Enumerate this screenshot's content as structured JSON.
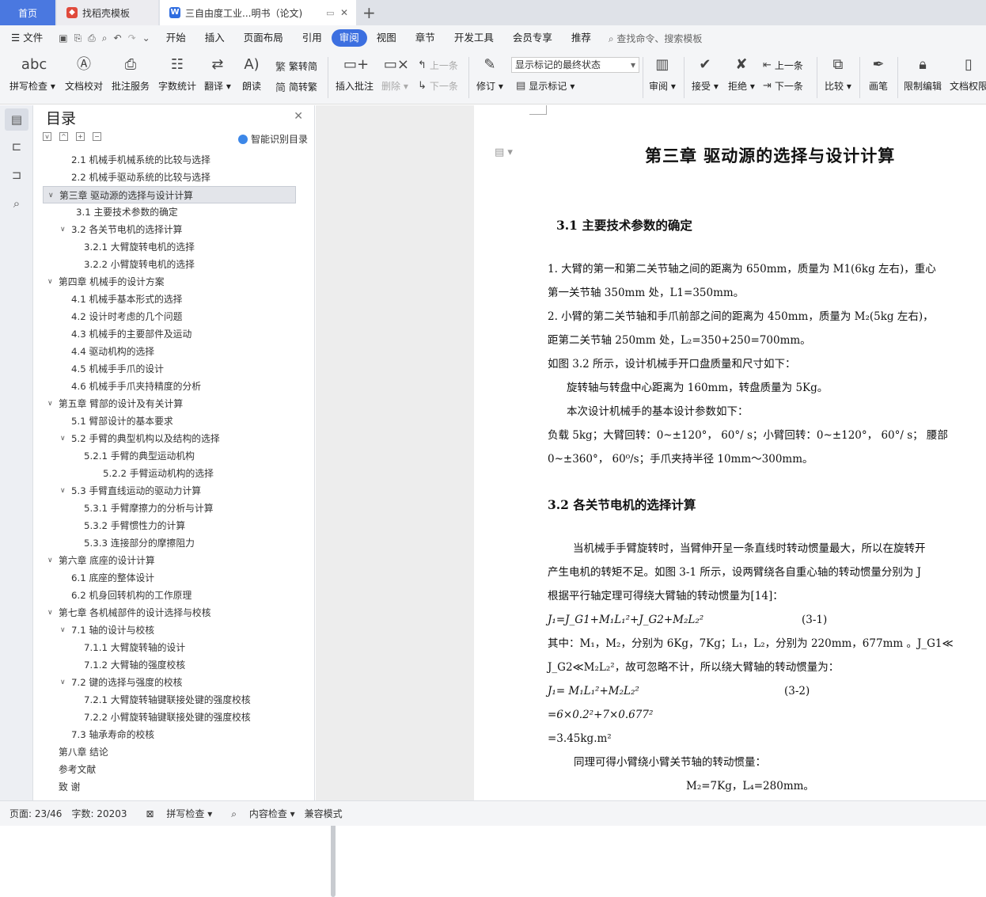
{
  "tabs": {
    "home": "首页",
    "template": "找稻壳模板",
    "document": "三自由度工业...明书（论文)"
  },
  "menu": {
    "file": "文件",
    "items": [
      "开始",
      "插入",
      "页面布局",
      "引用",
      "审阅",
      "视图",
      "章节",
      "开发工具",
      "会员专享",
      "推荐"
    ],
    "active_index": 4,
    "search": "查找命令、搜索模板"
  },
  "ribbon": {
    "spellcheck": "拼写检查",
    "proofread": "文档校对",
    "annotate_service": "批注服务",
    "word_count": "字数统计",
    "translate": "翻译",
    "read_aloud": "朗读",
    "trad": "繁转简",
    "simp": "简转繁",
    "insert_comment": "插入批注",
    "delete": "删除",
    "prev_comment": "上一条",
    "next_comment": "下一条",
    "revise": "修订",
    "markup_combo": "显示标记的最终状态",
    "show_markup": "显示标记",
    "review": "审阅",
    "accept": "接受",
    "reject": "拒绝",
    "prev_change": "上一条",
    "next_change": "下一条",
    "compare": "比较",
    "pen": "画笔",
    "restrict": "限制编辑",
    "doc_rights": "文档权限"
  },
  "toc": {
    "title": "目录",
    "smart": "智能识别目录",
    "items": [
      {
        "text": "2.1   机械手机械系统的比较与选择",
        "indent": 36,
        "arrow": ""
      },
      {
        "text": "2.2   机械手驱动系统的比较与选择",
        "indent": 36,
        "arrow": ""
      },
      {
        "text": "第三章   驱动源的选择与设计计算",
        "indent": 20,
        "arrow": "v",
        "selected": true
      },
      {
        "text": "3.1   主要技术参数的确定",
        "indent": 42,
        "arrow": ""
      },
      {
        "text": "3.2   各关节电机的选择计算",
        "indent": 36,
        "arrow": "v"
      },
      {
        "text": "3.2.1   大臂旋转电机的选择",
        "indent": 52,
        "arrow": ""
      },
      {
        "text": "3.2.2   小臂旋转电机的选择",
        "indent": 52,
        "arrow": ""
      },
      {
        "text": "第四章   机械手的设计方案",
        "indent": 20,
        "arrow": "v"
      },
      {
        "text": "4.1  机械手基本形式的选择",
        "indent": 36,
        "arrow": ""
      },
      {
        "text": "4.2   设计时考虑的几个问题",
        "indent": 36,
        "arrow": ""
      },
      {
        "text": "4.3 机械手的主要部件及运动",
        "indent": 36,
        "arrow": ""
      },
      {
        "text": "4.4 驱动机构的选择",
        "indent": 36,
        "arrow": ""
      },
      {
        "text": "4.5 机械手手爪的设计",
        "indent": 36,
        "arrow": ""
      },
      {
        "text": "4.6  机械手手爪夹持精度的分析",
        "indent": 36,
        "arrow": ""
      },
      {
        "text": "第五章   臂部的设计及有关计算",
        "indent": 20,
        "arrow": "v"
      },
      {
        "text": "5.1  臂部设计的基本要求",
        "indent": 36,
        "arrow": ""
      },
      {
        "text": "5.2  手臂的典型机构以及结构的选择",
        "indent": 36,
        "arrow": "v"
      },
      {
        "text": "5.2.1  手臂的典型运动机构",
        "indent": 52,
        "arrow": ""
      },
      {
        "text": "5.2.2  手臂运动机构的选择",
        "indent": 76,
        "arrow": ""
      },
      {
        "text": "5.3  手臂直线运动的驱动力计算",
        "indent": 36,
        "arrow": "v"
      },
      {
        "text": "5.3.1  手臂摩擦力的分析与计算",
        "indent": 52,
        "arrow": ""
      },
      {
        "text": "5.3.2  手臂惯性力的计算",
        "indent": 52,
        "arrow": ""
      },
      {
        "text": "5.3.3 连接部分的摩擦阻力",
        "indent": 52,
        "arrow": ""
      },
      {
        "text": "第六章   底座的设计计算",
        "indent": 20,
        "arrow": "v"
      },
      {
        "text": "6.1  底座的整体设计",
        "indent": 36,
        "arrow": ""
      },
      {
        "text": "6.2  机身回转机构的工作原理",
        "indent": 36,
        "arrow": ""
      },
      {
        "text": "第七章   各机械部件的设计选择与校核",
        "indent": 20,
        "arrow": "v"
      },
      {
        "text": "7.1    轴的设计与校核",
        "indent": 36,
        "arrow": "v"
      },
      {
        "text": "7.1.1    大臂旋转轴的设计",
        "indent": 52,
        "arrow": ""
      },
      {
        "text": "7.1.2    大臂轴的强度校核",
        "indent": 52,
        "arrow": ""
      },
      {
        "text": "7.2    键的选择与强度的校核",
        "indent": 36,
        "arrow": "v"
      },
      {
        "text": "7.2.1 大臂旋转轴键联接处键的强度校核",
        "indent": 52,
        "arrow": ""
      },
      {
        "text": "7.2.2 小臂旋转轴键联接处键的强度校核",
        "indent": 52,
        "arrow": ""
      },
      {
        "text": "7.3    轴承寿命的校核",
        "indent": 36,
        "arrow": ""
      },
      {
        "text": "第八章   结论",
        "indent": 20,
        "arrow": ""
      },
      {
        "text": "参考文献",
        "indent": 20,
        "arrow": ""
      },
      {
        "text": "致  谢",
        "indent": 20,
        "arrow": ""
      }
    ]
  },
  "doc": {
    "chapter_title": "第三章    驱动源的选择与设计计算",
    "sec31": "3.1    主要技术参数的确定",
    "l1": "1.   大臂的第一和第二关节轴之间的距离为 650mm，质量为 M1(6kg 左右)，重心",
    "l2": "第一关节轴 350mm 处，L1=350mm。",
    "l3": "2.   小臂的第二关节轴和手爪前部之间的距离为 450mm，质量为 M₂(5kg 左右)，",
    "l4": "距第二关节轴 250mm 处，L₂=350+250=700mm。",
    "l5": "如图 3.2 所示，设计机械手开口盘质量和尺寸如下：",
    "l6": "旋转轴与转盘中心距离为 160mm，转盘质量为 5Kg。",
    "l7": "本次设计机械手的基本设计参数如下：",
    "l8": "负载 5kg；大臂回转：0~±120°，  60°/ s；小臂回转：0~±120°，  60°/ s；   腰部",
    "l9": "0~±360°，  60⁰/s；手爪夹持半径 10mm～300mm。",
    "sec32": "3.2    各关节电机的选择计算",
    "m1": "当机械手手臂旋转时，当臂伸开呈一条直线时转动惯量最大，所以在旋转开",
    "m2": "产生电机的转矩不足。如图 3-1 所示，设两臂绕各自重心轴的转动惯量分别为 J",
    "m3": "根据平行轴定理可得绕大臂轴的转动惯量为[14]：",
    "eq1": "J₁=J_G1+M₁L₁²+J_G2+M₂L₂²",
    "eq1n": "(3-1)",
    "m4": "其中：M₁，M₂，分别为 6Kg，7Kg；L₁，L₂，分别为 220mm，677mm   。J_G1≪",
    "m5": "J_G2≪M₂L₂²，故可忽略不计，所以绕大臂轴的转动惯量为：",
    "eq2": "J₁= M₁L₁²+M₂L₂²",
    "eq2n": "(3-2)",
    "eq3": "=6×0.2²+7×0.677²",
    "eq4": "=3.45kg.m²",
    "m6": "同理可得小臂绕小臂关节轴的转动惯量：",
    "m7": "M₂=7Kg，L₄=280mm。"
  },
  "status": {
    "page": "页面: 23/46",
    "words": "字数: 20203",
    "spell": "拼写检查",
    "content_check": "内容检查",
    "compat": "兼容模式"
  }
}
